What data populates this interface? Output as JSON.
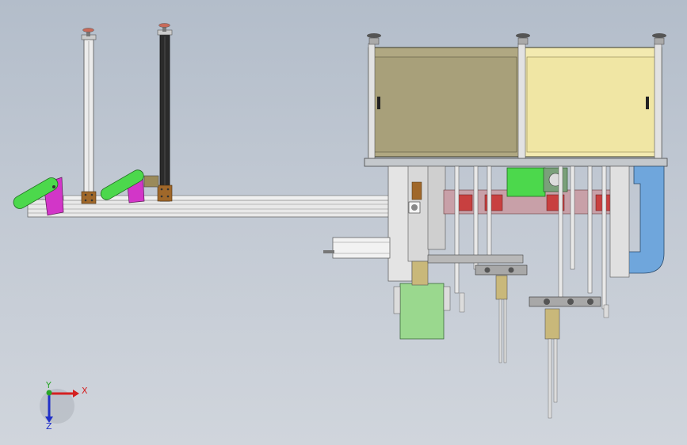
{
  "viewport": {
    "background_top": "#b3bdca",
    "background_bottom": "#d0d5dc"
  },
  "triad": {
    "x_label": "X",
    "y_label": "Y",
    "z_label": "Z",
    "x_color": "#d42020",
    "y_color": "#2aa52a",
    "z_color": "#2030c8"
  },
  "colors": {
    "cabinet_left": "#b0a882",
    "cabinet_right": "#f3eab0",
    "green_part": "#4cd84c",
    "magenta_part": "#d236c8",
    "blue_duct": "#6fa6dc",
    "light_green_box": "#9ad88e",
    "frame": "#e6e6e6",
    "steel": "#9aa3ad",
    "brass": "#c9b87a"
  },
  "icons": {
    "leveling_foot": "leveling-foot-icon"
  }
}
